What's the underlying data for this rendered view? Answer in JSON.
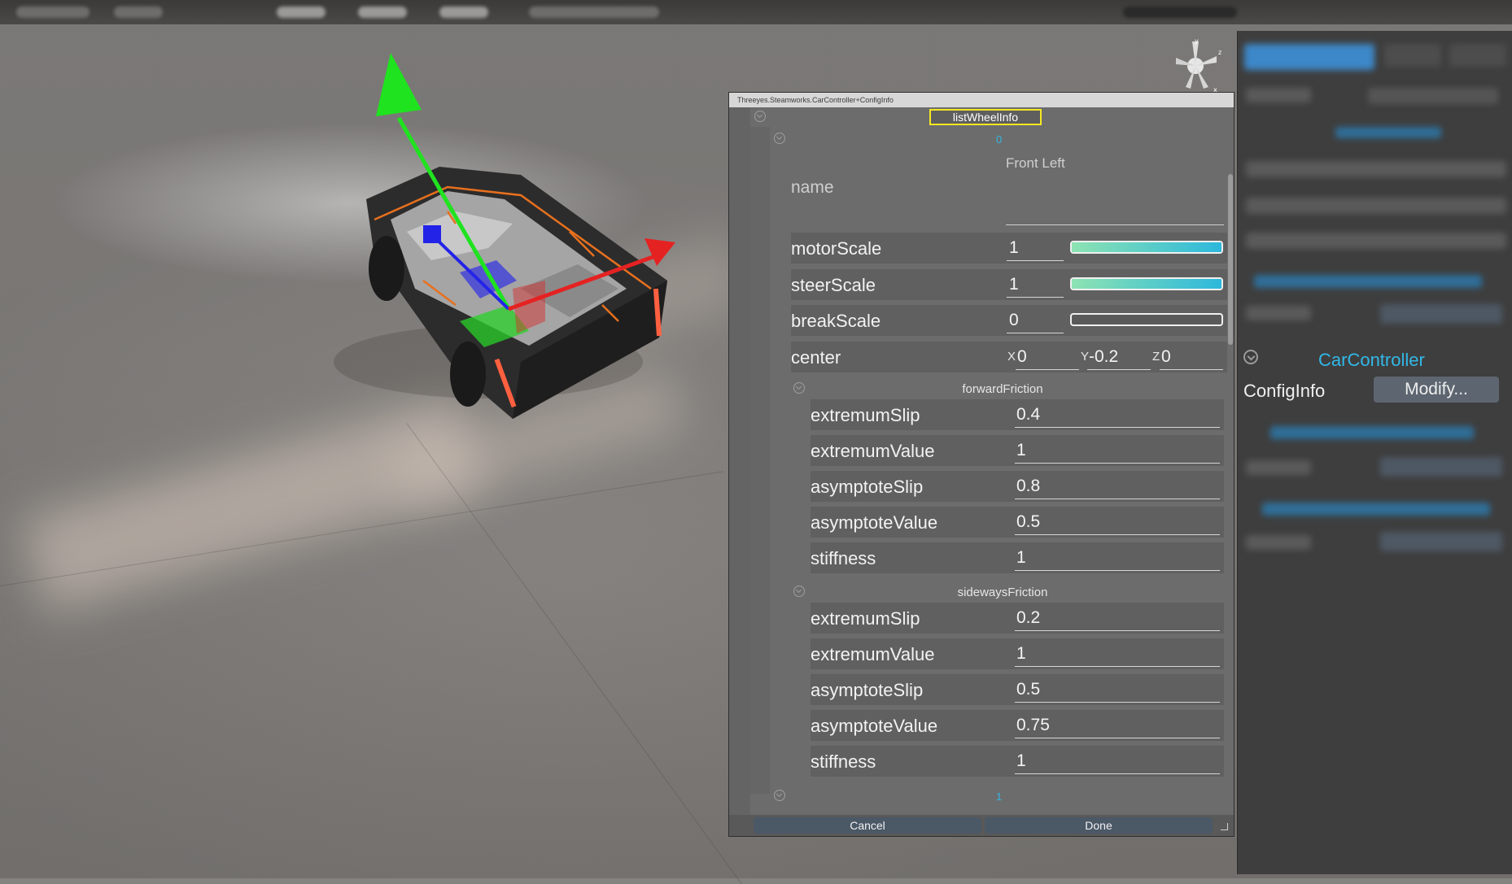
{
  "dialog": {
    "title": "Threeyes.Steamworks.CarController+ConfigInfo",
    "list_title": "listWheelInfo",
    "cancel": "Cancel",
    "done": "Done"
  },
  "wheel0": {
    "index": "0",
    "name_value": "Front Left",
    "name_label": "name",
    "motorScale": {
      "label": "motorScale",
      "value": "1",
      "slider_fraction": 1.0
    },
    "steerScale": {
      "label": "steerScale",
      "value": "1",
      "slider_fraction": 1.0
    },
    "breakScale": {
      "label": "breakScale",
      "value": "0",
      "slider_fraction": 0.0
    },
    "center": {
      "label": "center",
      "x_label": "X",
      "x": "0",
      "y_label": "Y",
      "y": "-0.2",
      "z_label": "Z",
      "z": "0"
    },
    "forwardFriction": {
      "title": "forwardFriction",
      "rows": [
        {
          "label": "extremumSlip",
          "value": "0.4"
        },
        {
          "label": "extremumValue",
          "value": "1"
        },
        {
          "label": "asymptoteSlip",
          "value": "0.8"
        },
        {
          "label": "asymptoteValue",
          "value": "0.5"
        },
        {
          "label": "stiffness",
          "value": "1"
        }
      ]
    },
    "sidewaysFriction": {
      "title": "sidewaysFriction",
      "rows": [
        {
          "label": "extremumSlip",
          "value": "0.2"
        },
        {
          "label": "extremumValue",
          "value": "1"
        },
        {
          "label": "asymptoteSlip",
          "value": "0.5"
        },
        {
          "label": "asymptoteValue",
          "value": "0.75"
        },
        {
          "label": "stiffness",
          "value": "1"
        }
      ]
    }
  },
  "wheel1": {
    "index": "1"
  },
  "inspector": {
    "component": "CarController",
    "config_label": "ConfigInfo",
    "modify": "Modify..."
  },
  "colors": {
    "accent": "#32b8e8",
    "highlight": "#f4e823",
    "slider_start": "#8de3b2",
    "slider_end": "#2cb8dc",
    "axis_x": "#e52222",
    "axis_y": "#1fe31f",
    "axis_z": "#2323e8"
  },
  "icons": [
    "collapse-icon",
    "axis-gizmo-icon",
    "resize-handle-icon"
  ]
}
